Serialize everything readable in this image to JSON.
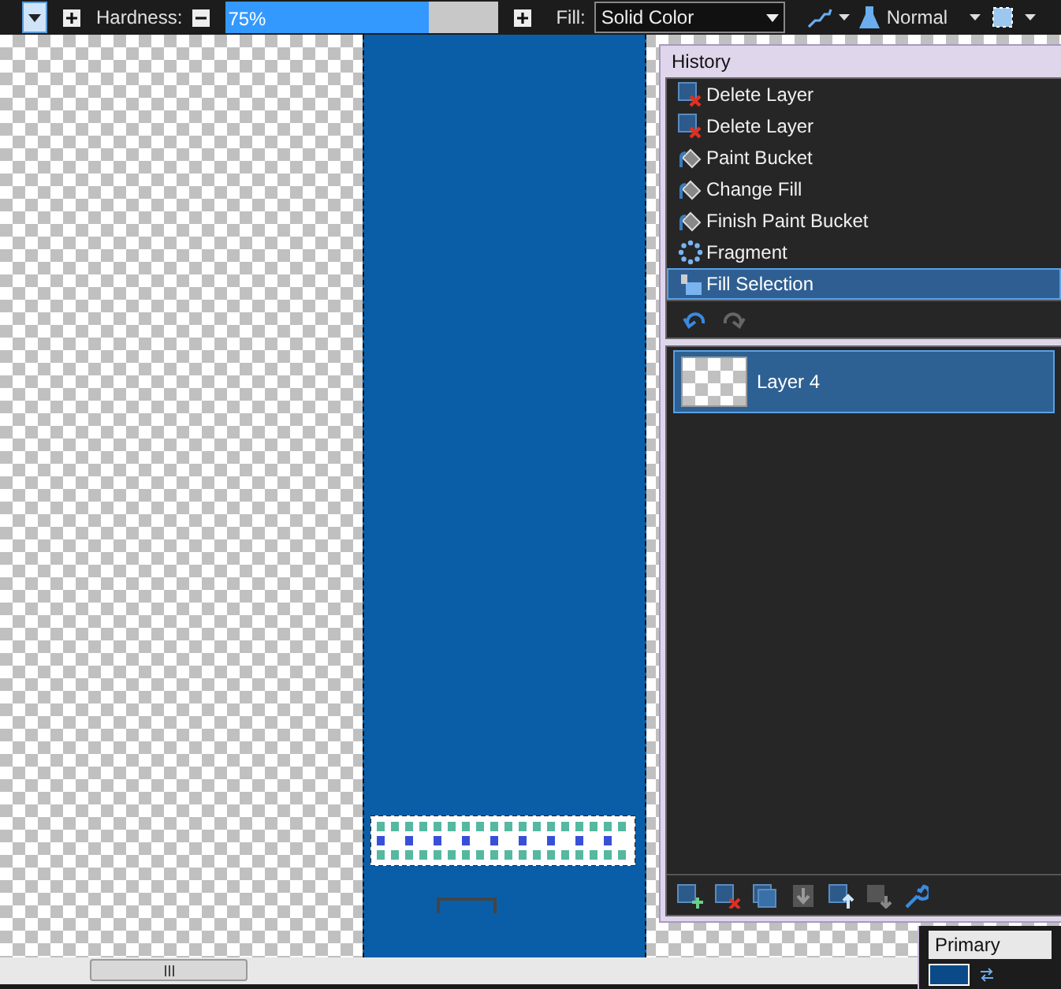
{
  "toolbar": {
    "hardness_label": "Hardness:",
    "hardness": {
      "value": "75%",
      "level": 0.75
    },
    "fill_label": "Fill:",
    "fill_value": "Solid Color",
    "blend_mode": "Normal"
  },
  "history": {
    "title": "History",
    "items": [
      {
        "label": "Delete Layer",
        "kind": "delete-layer",
        "selected": false
      },
      {
        "label": "Delete Layer",
        "kind": "delete-layer",
        "selected": false
      },
      {
        "label": "Paint Bucket",
        "kind": "paint-bucket",
        "selected": false
      },
      {
        "label": "Change Fill",
        "kind": "paint-bucket",
        "selected": false
      },
      {
        "label": "Finish Paint Bucket",
        "kind": "paint-bucket",
        "selected": false
      },
      {
        "label": "Fragment",
        "kind": "fragment",
        "selected": false
      },
      {
        "label": "Fill Selection",
        "kind": "fill-selection",
        "selected": true
      }
    ]
  },
  "layers": [
    {
      "name": "Layer 4",
      "selected": true
    }
  ],
  "colors": {
    "title": "Primary"
  }
}
